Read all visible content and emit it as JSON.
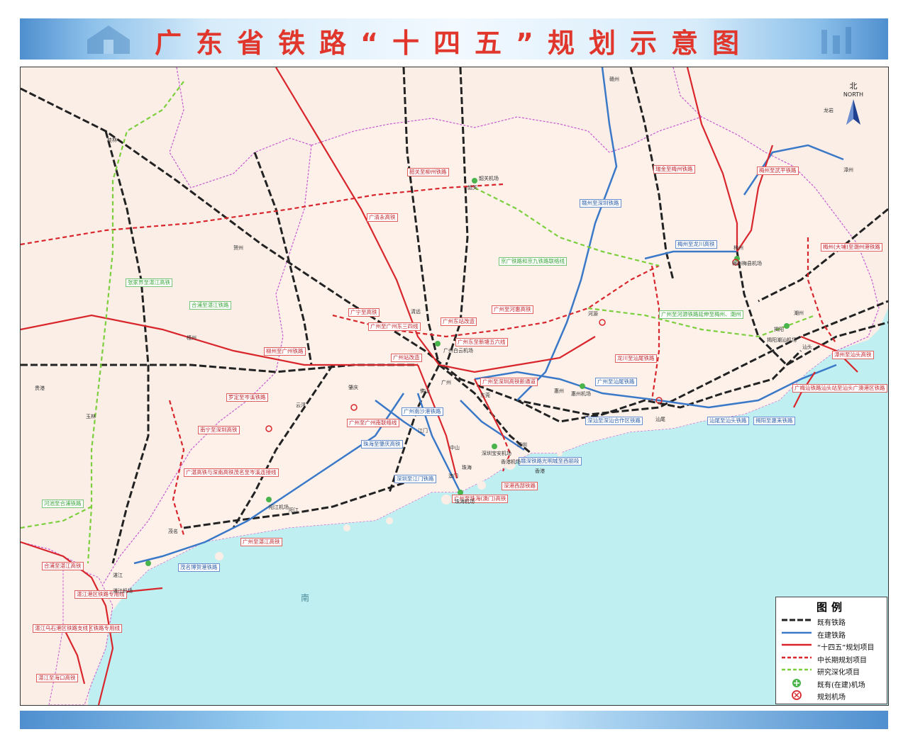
{
  "header": {
    "title": "广东省铁路“十四五”规划示意图"
  },
  "compass": {
    "label_cn": "北",
    "label_en": "NORTH"
  },
  "legend": {
    "title": "图例",
    "items": [
      {
        "label": "既有铁路",
        "kind": "existing",
        "color": "#222222"
      },
      {
        "label": "在建铁路",
        "kind": "construction",
        "color": "#3a78c8"
      },
      {
        "label": "“十四五”规划项目",
        "kind": "plan145",
        "color": "#d9262c"
      },
      {
        "label": "中长期规划项目",
        "kind": "longterm",
        "color": "#d9262c"
      },
      {
        "label": "研究深化项目",
        "kind": "study",
        "color": "#7ccf3c"
      },
      {
        "label": "既有(在建)机场",
        "kind": "airport-existing",
        "color": "#48b44b"
      },
      {
        "label": "规划机场",
        "kind": "airport-planned",
        "color": "#d9262c"
      }
    ]
  },
  "sea_label": "南",
  "colors": {
    "land": "#fbeee6",
    "sea": "#bfeff0",
    "border": "#c85ad0",
    "existing": "#222222",
    "construction": "#3a78c8",
    "plan": "#d9262c",
    "study": "#7ccf3c"
  },
  "labels_red": [
    "韶关至柳州铁路",
    "广清永高铁",
    "广宁至高铁",
    "广州至广州东三四线",
    "广州东站改造",
    "广州至河惠高铁",
    "广州东至新塘五六线",
    "广州站改造",
    "柳州至广州铁路",
    "罗定至岑溪铁路",
    "南宁至深圳高铁",
    "广州至广州南联络线",
    "广州至深圳高铁新通道",
    "广湛高铁与深南高铁茂名至岑溪连接线",
    "龙川至汕尾铁路",
    "梅州至武平铁路",
    "瑞金至梅州铁路",
    "梅州(大埔)至潮州港铁路",
    "漳州至汕头高铁",
    "广梅汕铁路汕头站至汕头广澳港区铁路",
    "广州至珠海(澳门)高铁",
    "深港西部铁路",
    "湛江港区铁路专用线",
    "东海岛港区铁路专用线",
    "合浦至湛江高铁",
    "湛江乌石港区铁路支线",
    "湛江至海口高铁",
    "广州至湛江高铁"
  ],
  "labels_blue": [
    "赣州至深圳铁路",
    "梅州至龙川高铁",
    "广州至汕尾铁路",
    "深汕至深汕合作区铁路",
    "汕尾至汕头铁路",
    "揭阳至惠来铁路",
    "广州南沙港铁路",
    "珠海至肇庆高铁",
    "深圳至江门铁路",
    "茂名博贺港铁路",
    "赣深铁路光明城至西丽段"
  ],
  "labels_green": [
    "京广铁路和京九铁路联络线",
    "广州至河源铁路延伸至梅州、潮州",
    "张家界至湛江高铁",
    "合浦至湛江铁路",
    "河池至合浦铁路"
  ],
  "city_names": [
    "韶关",
    "清远",
    "广州",
    "佛山",
    "肇庆",
    "云浮",
    "江门",
    "中山",
    "珠海",
    "澳门",
    "深圳",
    "香港",
    "东莞",
    "惠州",
    "河源",
    "汕尾",
    "梅州",
    "潮州",
    "汕头",
    "揭阳",
    "阳江",
    "茂名",
    "湛江",
    "贵港",
    "玉林",
    "梧州",
    "桂林",
    "贺州",
    "赣州",
    "龙岩",
    "漳州"
  ],
  "airports": [
    "韶关机场",
    "广州白云机场",
    "珠海机场",
    "深圳宝安机场",
    "香港机场",
    "惠州机场",
    "揭阳潮汕机场",
    "梅州梅县机场",
    "湛江机场",
    "阳江机场"
  ]
}
